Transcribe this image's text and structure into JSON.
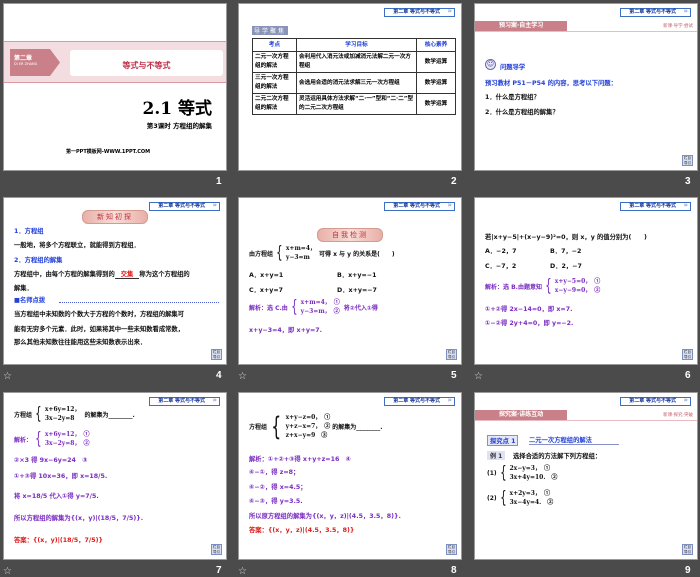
{
  "common": {
    "chapter_tag": "第二章 等式与不等式",
    "back_button": "栏目导引"
  },
  "slides": [
    {
      "number": "1",
      "chapter": "第二章",
      "chapter_pinyin": "DI ER ZHANG",
      "unit_title": "等式与不等式",
      "title": "2.1 等式",
      "subtitle": "第3课时 方程组的解集",
      "footer": "第一PPT模板网-WWW.1PPT.COM"
    },
    {
      "number": "2",
      "section": "导学聚焦",
      "headers": [
        "考点",
        "学习目标",
        "核心素养"
      ],
      "rows": [
        [
          "二元一次方程组的解法",
          "会利用代入消元法或加减消元法解二元一次方程组",
          "数学运算"
        ],
        [
          "三元一次方程组的解法",
          "会选用合适的消元法求解三元一次方程组",
          "数学运算"
        ],
        [
          "二元二次方程组的解法",
          "灵活运用具体方法求解“二·一”型和“二·二”型的二元二次方程组",
          "数学运算"
        ]
      ]
    },
    {
      "number": "3",
      "banner": "预习案·自主学习",
      "banner_right": "新课·导学·尝试",
      "heading": "问题导学",
      "intro": "预习教材 P51－P54 的内容，思考以下问题：",
      "q1": "1．什么是方程组？",
      "q2": "2．什么是方程组的解集？"
    },
    {
      "number": "4",
      "ribbon": "新知初探",
      "h1": "1．方程组",
      "p1": "一般地，将多个方程联立，就能得到方程组．",
      "h2": "2．方程组的解集",
      "p2a": "方程组中，由每个方程的解集得到的",
      "blank": "交集",
      "p2b": "称为这个方程组的",
      "p2c": "解集．",
      "note_head": "■名师点拨",
      "n1": "当方程组中未知数的个数大于方程的个数时，方程组的解集可",
      "n2": "能有无穷多个元素．此时，如果将其中一些未知数看成常数，",
      "n3": "那么其他未知数往往能用这些未知数表示出来．"
    },
    {
      "number": "5",
      "ribbon": "自我检测",
      "q_pre": "由方程组",
      "q_eq1": "x+m=4，",
      "q_eq2": "y−3=m",
      "q_post": "可得 x 与 y 的关系是(　　)",
      "optA": "A．x+y=1",
      "optB": "B．x+y=−1",
      "optC": "C．x+y=7",
      "optD": "D．x+y=−7",
      "sol_pre": "解析：选 C.由",
      "sol_eq1": "x+m=4，　①",
      "sol_eq2": "y−3=m，　②",
      "sol_post": "将②代入①得",
      "sol_line2": "x+y−3=4，即 x+y=7."
    },
    {
      "number": "6",
      "q": "若|x+y−5|+(x−y−9)²=0，则 x，y 的值分别为(　　)",
      "optA": "A．−2，7",
      "optB": "B．7，−2",
      "optC": "C．−7，2",
      "optD": "D．2，−7",
      "sol_pre": "解析：选 B.由题意知",
      "sol_eq1": "x+y−5=0，　①",
      "sol_eq2": "x−y−9=0，　②",
      "l1": "①+②得 2x−14=0，即 x=7.",
      "l2": "①−②得 2y+4=0，即 y=−2."
    },
    {
      "number": "7",
      "q_pre": "方程组",
      "q_eq1": "x+6y=12，",
      "q_eq2": "3x−2y=8",
      "q_post": "的解集为________.",
      "sol_pre": "解析：",
      "sol_eq1": "x+6y=12，　①",
      "sol_eq2": "3x−2y=8，　②",
      "l1": "②×3 得 9x−6y=24　③",
      "l2": "①+③得 10x=36，即 x=18/5.",
      "l3": "将 x=18/5 代入①得 y=7/5.",
      "l4": "所以方程组的解集为{(x，y)|(18/5，7/5)}.",
      "answer": "答案：{(x，y)|(18/5，7/5)}"
    },
    {
      "number": "8",
      "q_pre": "方程组",
      "q_eq1": "x+y−z=0，　①",
      "q_eq2": "y+z−x=7，　②",
      "q_eq3": "z+x−y=9　③",
      "q_post": "的解集为________.",
      "l1": "解析：①+②+③得 x+y+z=16　④",
      "l2": "④−①，得 z=8；",
      "l3": "④−②，得 x=4.5；",
      "l4": "④−③，得 y=3.5.",
      "l5": "所以原方程组的解集为{(x，y，z)|(4.5，3.5，8)}.",
      "answer": "答案：{(x，y，z)|(4.5，3.5，8)}"
    },
    {
      "number": "9",
      "banner": "探究案·讲练互动",
      "banner_right": "新课·探究·突破",
      "point": "探究点 1",
      "point_title": "二元一次方程组的解法",
      "example": "例 1",
      "example_text": "选择合适的方法解下列方程组：",
      "p1_label": "(1)",
      "p1_eq1": "2x−y=3，　①",
      "p1_eq2": "3x+4y=10.　②",
      "p2_label": "(2)",
      "p2_eq1": "x+2y=3，　①",
      "p2_eq2": "3x−4y=4.　②"
    }
  ]
}
